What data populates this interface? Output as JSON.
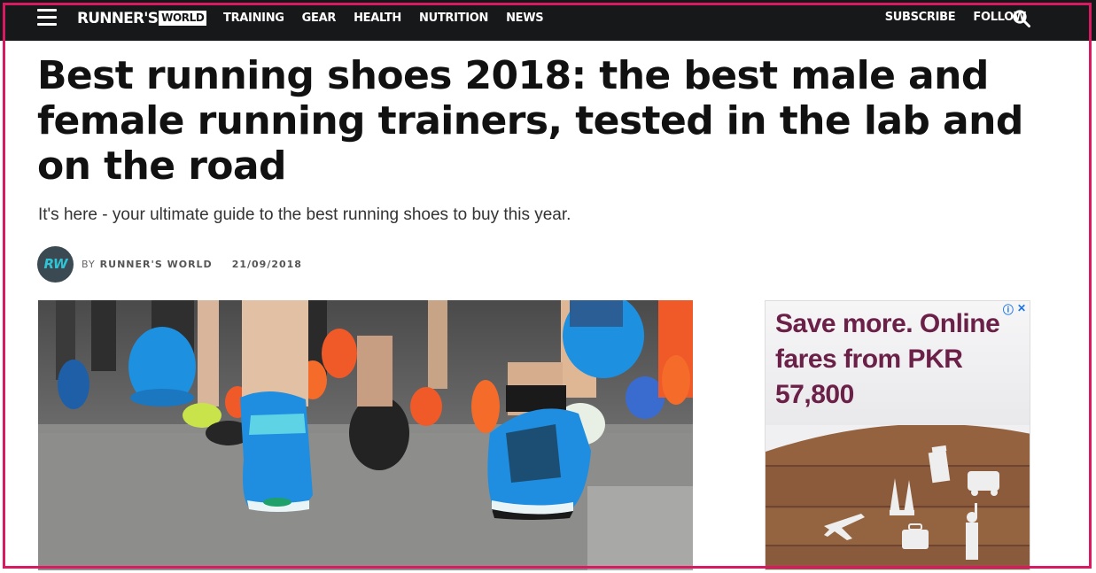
{
  "header": {
    "logo_main": "RUNNER'S",
    "logo_box": "WORLD",
    "nav": [
      "TRAINING",
      "GEAR",
      "HEALTH",
      "NUTRITION",
      "NEWS"
    ],
    "subscribe": "SUBSCRIBE",
    "follow": "FOLLOW"
  },
  "article": {
    "headline": "Best running shoes 2018: the best male and female running trainers, tested in the lab and on the road",
    "dek": "It's here - your ultimate guide to the best running shoes to buy this year.",
    "avatar_text": "RW",
    "by_prefix": "BY",
    "author": "RUNNER'S WORLD",
    "date": "21/09/2018"
  },
  "ad": {
    "headline": "Save more. Online fares from PKR 57,800",
    "info": "ⓘ",
    "close": "✕"
  },
  "colors": {
    "topbar": "#16181a",
    "ad_text": "#6b2048",
    "frame": "#d81b60"
  }
}
